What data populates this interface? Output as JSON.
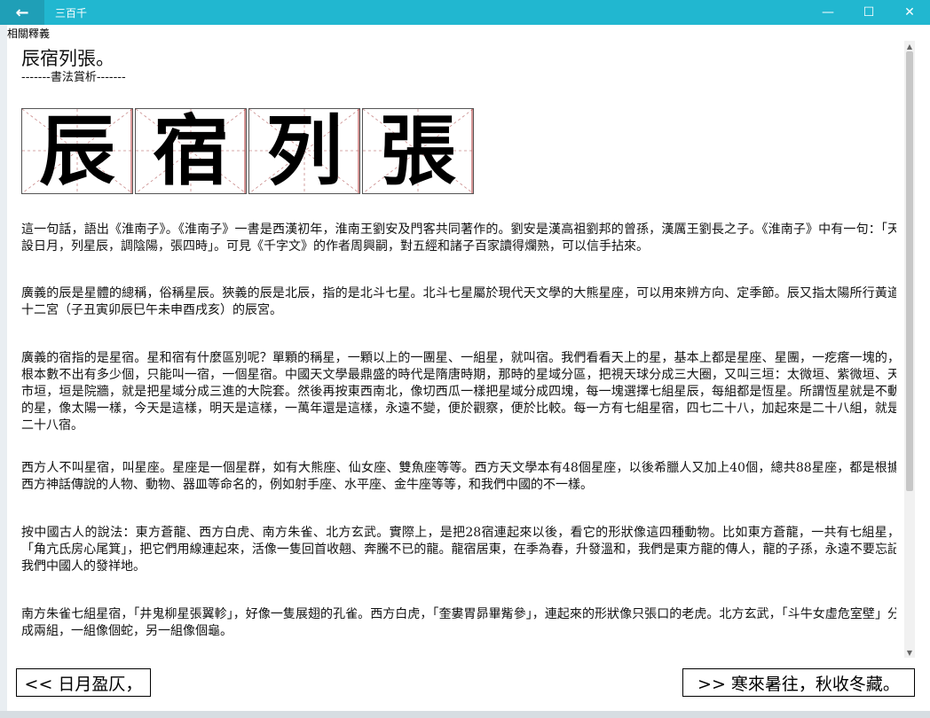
{
  "window": {
    "title": "三百千",
    "back_icon": "←",
    "minimize_icon": "—",
    "maximize_icon": "☐",
    "close_icon": "✕"
  },
  "section_label": "相關釋義",
  "heading": "辰宿列張。",
  "subheading": "-------書法賞析-------",
  "calligraphy": [
    "辰",
    "宿",
    "列",
    "張"
  ],
  "paragraphs": [
    "這一句話，語出《淮南子》。《淮南子》一書是西漢初年，淮南王劉安及門客共同著作的。劉安是漢高祖劉邦的曾孫，漢厲王劉長之子。《淮南子》中有一句：「天設日月，列星辰，調陰陽，張四時」。可見《千字文》的作者周興嗣，對五經和諸子百家讀得爛熟，可以信手拈來。",
    "廣義的辰是星體的總稱，俗稱星辰。狹義的辰是北辰，指的是北斗七星。北斗七星屬於現代天文學的大熊星座，可以用來辨方向、定季節。辰又指太陽所行黃道十二宮（子丑寅卯辰巳午未申酉戌亥）的辰宮。",
    "廣義的宿指的是星宿。星和宿有什麼區別呢？單顆的稱星，一顆以上的一團星、一組星，就叫宿。我們看看天上的星，基本上都是星座、星團，一疙瘩一塊的，根本數不出有多少個，只能叫一宿，一個星宿。中國天文學最鼎盛的時代是隋唐時期，那時的星域分區，把視天球分成三大圈，又叫三垣：太微垣、紫微垣、天市垣，垣是院牆，就是把星域分成三進的大院套。然後再按東西南北，像切西瓜一樣把星域分成四塊，每一塊選擇七組星辰，每組都是恆星。所謂恆星就是不動的星，像太陽一樣，今天是這樣，明天是這樣，一萬年還是這樣，永遠不變，便於觀察，便於比較。每一方有七組星宿，四七二十八，加起來是二十八組，就是二十八宿。",
    "西方人不叫星宿，叫星座。星座是一個星群，如有大熊座、仙女座、雙魚座等等。西方天文學本有48個星座，以後希臘人又加上40個，總共88星座，都是根據西方神話傳說的人物、動物、器皿等命名的，例如射手座、水平座、金牛座等等，和我們中國的不一樣。",
    "按中國古人的說法：東方蒼龍、西方白虎、南方朱雀、北方玄武。實際上，是把28宿連起來以後，看它的形狀像這四種動物。比如東方蒼龍，一共有七組星，「角亢氐房心尾箕」，把它們用線連起來，活像一隻回首收翹、奔騰不已的龍。龍宿居東，在季為春，升發溫和，我們是東方龍的傳人，龍的子孫，永遠不要忘記我們中國人的發祥地。",
    "南方朱雀七組星宿，「井鬼柳星張翼軫」，好像一隻展翅的孔雀。西方白虎，「奎婁胃昴畢觜參」，連起來的形狀像只張口的老虎。北方玄武，「斗牛女虛危室壁」分成兩組，一組像個蛇，另一組像個龜。"
  ],
  "nav": {
    "prev": "<< 日月盈仄，",
    "next": ">> 寒來暑往，秋收冬藏。"
  }
}
